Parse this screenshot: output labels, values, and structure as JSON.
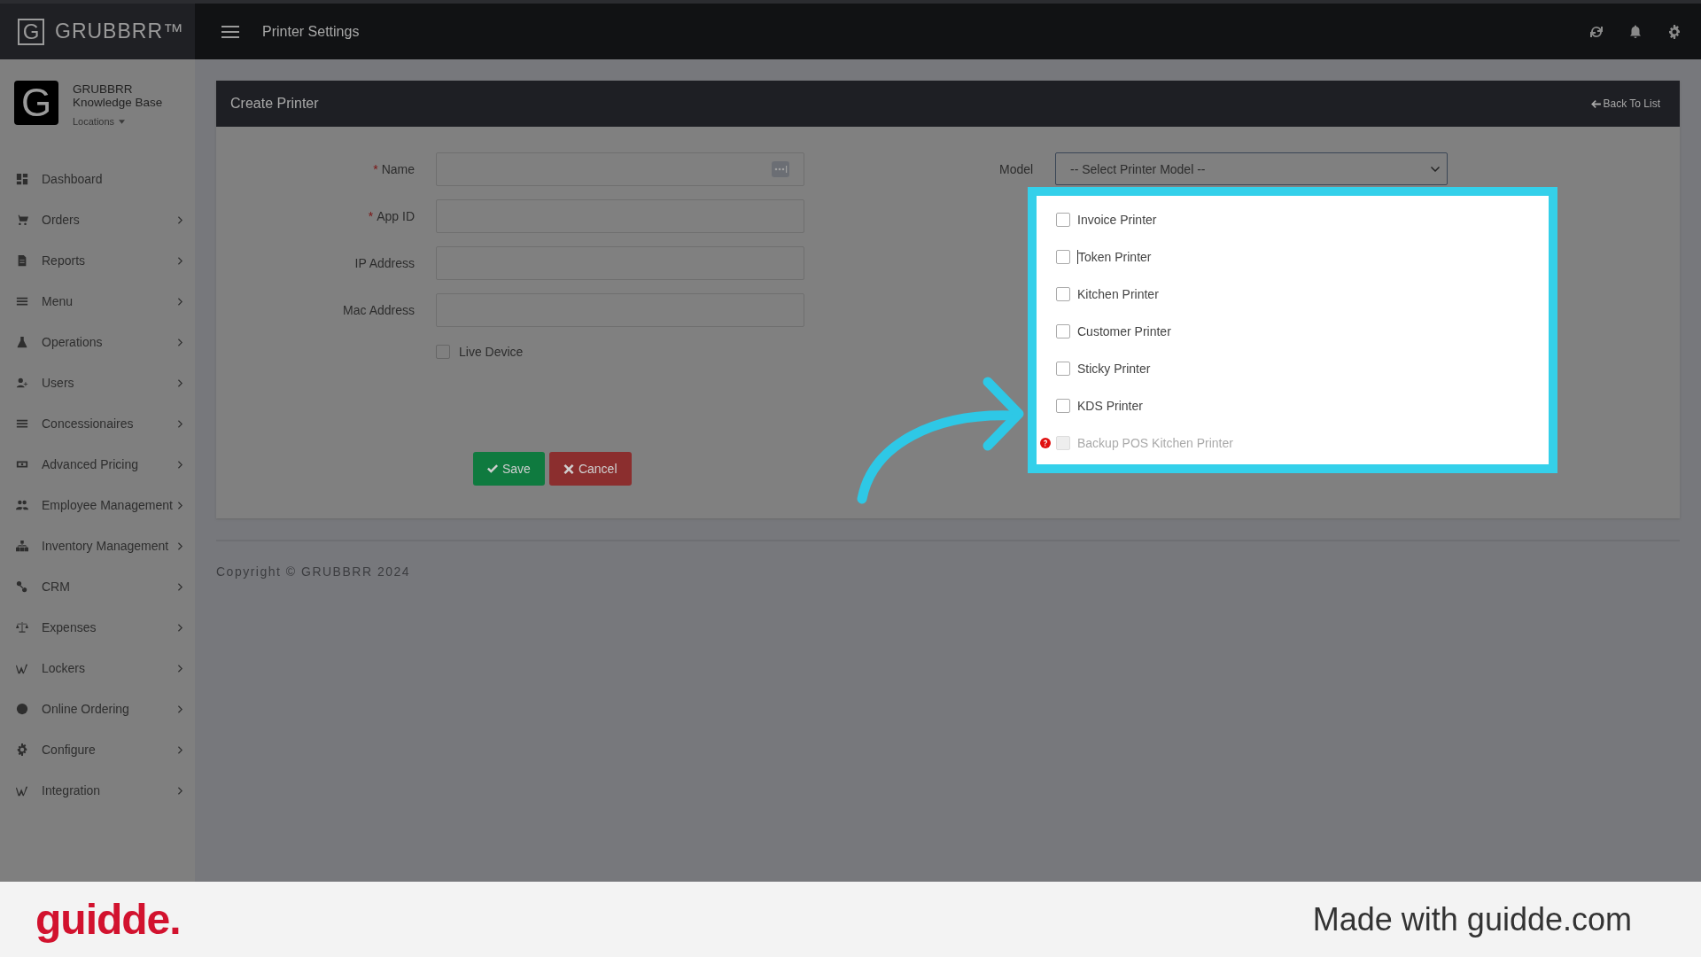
{
  "brand": {
    "mark": "G",
    "name": "GRUBBRR™"
  },
  "top_bar": {
    "title": "Printer Settings"
  },
  "account": {
    "mark": "G",
    "name": "GRUBBRR Knowledge Base",
    "locations": "Locations"
  },
  "sidebar": {
    "items": [
      {
        "label": "Dashboard",
        "has_submenu": false
      },
      {
        "label": "Orders",
        "has_submenu": true
      },
      {
        "label": "Reports",
        "has_submenu": true
      },
      {
        "label": "Menu",
        "has_submenu": true
      },
      {
        "label": "Operations",
        "has_submenu": true
      },
      {
        "label": "Users",
        "has_submenu": true
      },
      {
        "label": "Concessionaires",
        "has_submenu": true
      },
      {
        "label": "Advanced Pricing",
        "has_submenu": true
      },
      {
        "label": "Employee Management",
        "has_submenu": true
      },
      {
        "label": "Inventory Management",
        "has_submenu": true
      },
      {
        "label": "CRM",
        "has_submenu": true
      },
      {
        "label": "Expenses",
        "has_submenu": true
      },
      {
        "label": "Lockers",
        "has_submenu": true
      },
      {
        "label": "Online Ordering",
        "has_submenu": true
      },
      {
        "label": "Configure",
        "has_submenu": true
      },
      {
        "label": "Integration",
        "has_submenu": true
      }
    ]
  },
  "panel": {
    "title": "Create Printer",
    "back_link": "Back To List"
  },
  "form": {
    "fields": [
      {
        "label": "Name",
        "required": true,
        "kind": "name"
      },
      {
        "label": "App ID",
        "required": true,
        "kind": "text"
      },
      {
        "label": "IP Address",
        "required": false,
        "kind": "text"
      },
      {
        "label": "Mac Address",
        "required": false,
        "kind": "text"
      }
    ],
    "required_mark": "*",
    "live_device": {
      "label": "Live Device",
      "checked": false
    },
    "model": {
      "label": "Model",
      "value": "-- Select Printer Model --"
    },
    "printer_types": [
      {
        "label": "Invoice Printer",
        "checked": false,
        "disabled": false,
        "help": false,
        "cursor": false
      },
      {
        "label": "Token Printer",
        "checked": false,
        "disabled": false,
        "help": false,
        "cursor": true
      },
      {
        "label": "Kitchen Printer",
        "checked": false,
        "disabled": false,
        "help": false,
        "cursor": false
      },
      {
        "label": "Customer Printer",
        "checked": false,
        "disabled": false,
        "help": false,
        "cursor": false
      },
      {
        "label": "Sticky Printer",
        "checked": false,
        "disabled": false,
        "help": false,
        "cursor": false
      },
      {
        "label": "KDS Printer",
        "checked": false,
        "disabled": false,
        "help": false,
        "cursor": false
      },
      {
        "label": "Backup POS Kitchen Printer",
        "checked": false,
        "disabled": true,
        "help": true,
        "cursor": false
      }
    ],
    "buttons": [
      {
        "label": "Save",
        "kind": "save"
      },
      {
        "label": "Cancel",
        "kind": "cancel"
      }
    ]
  },
  "copyright": "Copyright © GRUBBRR 2024",
  "footer": {
    "logo": "guidde.",
    "tagline": "Made with guidde.com"
  }
}
